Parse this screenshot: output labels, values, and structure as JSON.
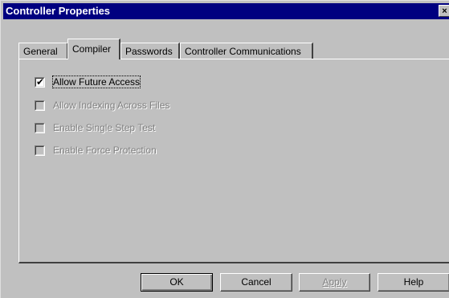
{
  "window": {
    "title": "Controller Properties",
    "close_glyph": "×"
  },
  "tabs": [
    {
      "label": "General",
      "active": false
    },
    {
      "label": "Compiler",
      "active": true
    },
    {
      "label": "Passwords",
      "active": false
    },
    {
      "label": "Controller Communications",
      "active": false
    }
  ],
  "options": [
    {
      "label": "Allow Future Access",
      "checked": true,
      "enabled": true
    },
    {
      "label": "Allow Indexing Across Files",
      "checked": false,
      "enabled": false
    },
    {
      "label": "Enable Single Step Test",
      "checked": false,
      "enabled": false
    },
    {
      "label": "Enable Force Protection",
      "checked": false,
      "enabled": false
    }
  ],
  "buttons": {
    "ok": "OK",
    "cancel": "Cancel",
    "apply": "Apply",
    "help": "Help"
  },
  "checkmark_glyph": "✔"
}
